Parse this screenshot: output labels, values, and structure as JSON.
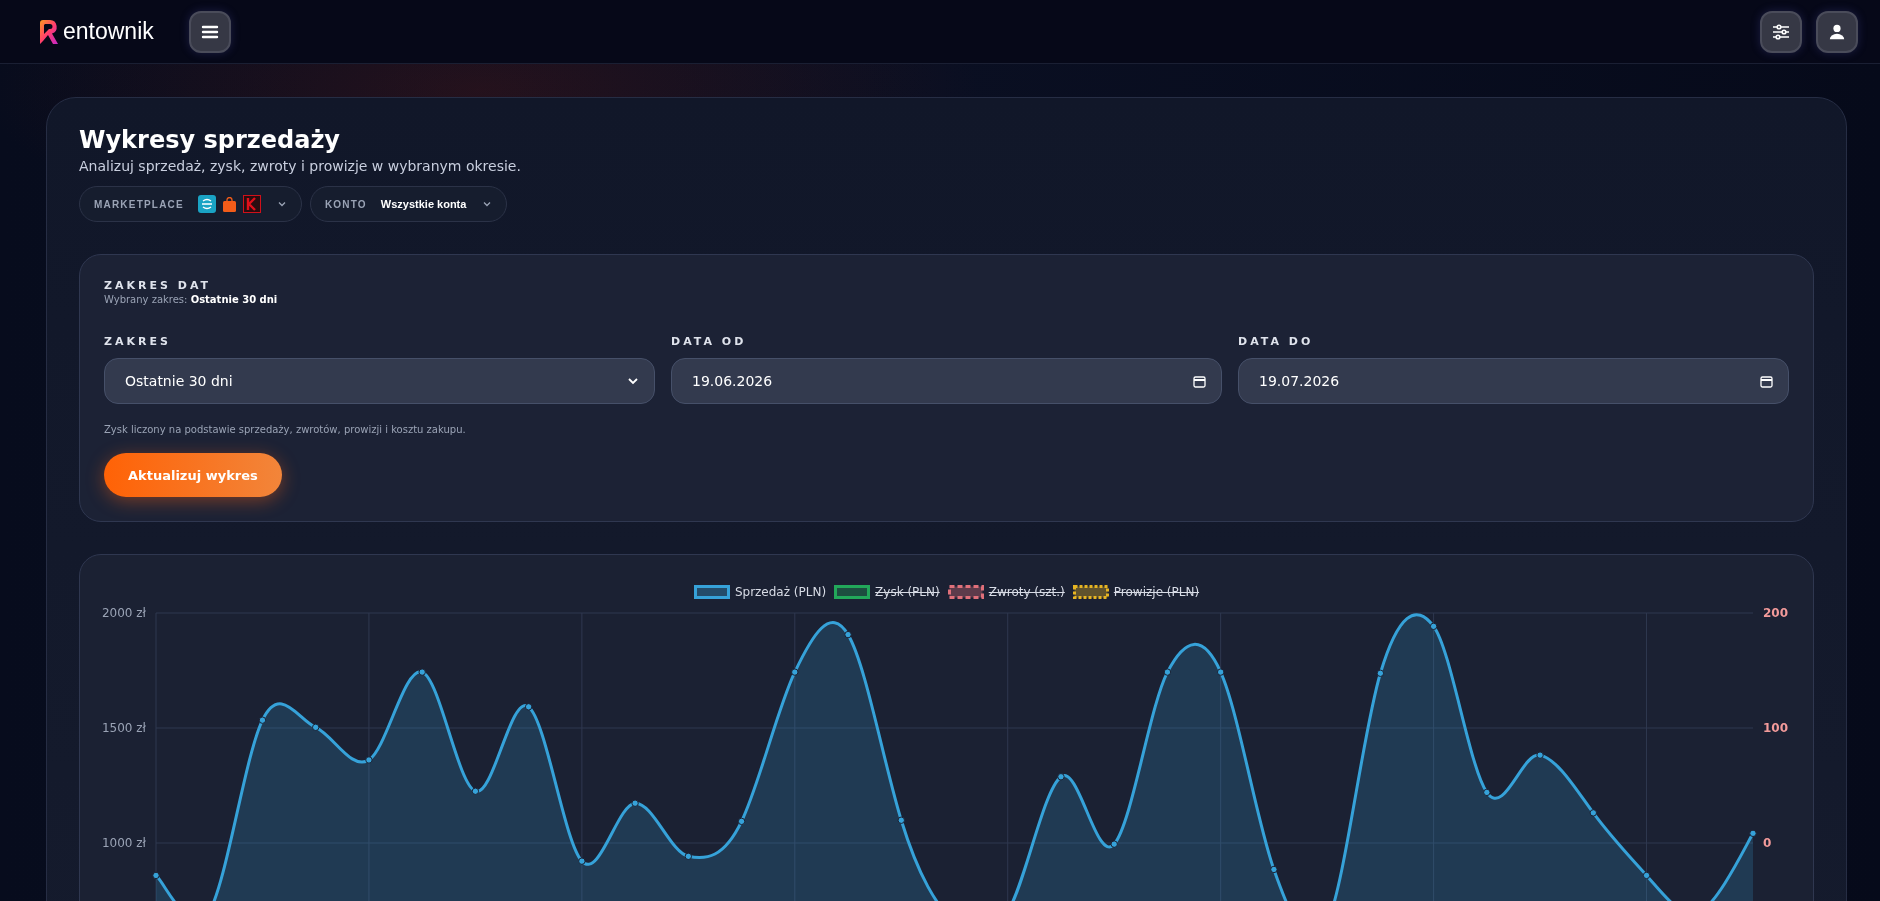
{
  "header": {
    "logo_text": "entownik"
  },
  "page": {
    "title": "Wykresy sprzedaży",
    "subtitle": "Analizuj sprzedaż, zysk, zwroty i prowizje w wybranym okresie."
  },
  "filters": [
    {
      "kind": "logos",
      "label": "MARKETPLACE"
    },
    {
      "kind": "text",
      "label": "KONTO",
      "value": "Wszystkie konta"
    }
  ],
  "date_range": {
    "title": "ZAKRES DAT",
    "summary": "Wybrany zakres: **Ostatnie 30 dni**",
    "fields": [
      {
        "kind": "select",
        "label": "ZAKRES",
        "value": "Ostatnie 30 dni"
      },
      {
        "kind": "date",
        "label": "DATA OD",
        "value": "19.06.2026"
      },
      {
        "kind": "date",
        "label": "DATA DO",
        "value": "19.07.2026"
      }
    ],
    "note": "Zysk liczony na podstawie sprzedaży, zwrotów, prowizji i kosztu zakupu.",
    "button": "Aktualizuj wykres"
  },
  "chart": {
    "legend": [
      {
        "hidden": false,
        "color": "#36a2d9"
      },
      {
        "label": "Zysk (PLN)",
        "hidden": true,
        "color": "#22a85a"
      },
      {
        "label": "Zwroty (szt.)",
        "hidden": true,
        "color": "#e0707a"
      },
      {
        "label": "Prowizje (PLN)",
        "hidden": true,
        "color": "#e6b422"
      }
    ],
    "chart_data": {
      "type": "area",
      "grid": true,
      "ylim": [
        500,
        2000
      ],
      "y2lim": [
        -100,
        200
      ],
      "series": [
        {
          "name": "Sprzedaż (PLN)",
          "color": "#36a2d9",
          "values": [
            859,
            700,
            1534,
            1503,
            1361,
            1743,
            1225,
            1592,
            921,
            1173,
            942,
            1094,
            1743,
            1906,
            1099,
            650,
            700,
            1288,
            995,
            1743,
            1743,
            885,
            650,
            1738,
            1942,
            1220,
            1382,
            1131,
            859,
            700,
            1042
          ]
        }
      ],
      "yticks": [
        {
          "value": 1000,
          "label": "1000 zł"
        },
        {
          "value": 1500,
          "label": "1500 zł"
        },
        {
          "value": 2000,
          "label": "2000 zł"
        }
      ],
      "y2ticks": [
        {
          "value": 0,
          "label": "0"
        },
        {
          "value": 100,
          "label": "100"
        },
        {
          "value": 200,
          "label": "200"
        }
      ]
    }
  }
}
